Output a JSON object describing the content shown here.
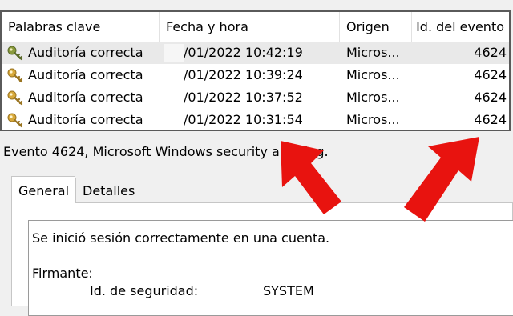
{
  "columns": {
    "keywords": "Palabras clave",
    "datetime": "Fecha y hora",
    "source": "Origen",
    "event_id": "Id. del evento"
  },
  "rows": [
    {
      "keyword": "Auditoría correcta",
      "datetime": "/01/2022 10:42:19",
      "source": "Micros...",
      "event_id": "4624",
      "selected": true
    },
    {
      "keyword": "Auditoría correcta",
      "datetime": "/01/2022 10:39:24",
      "source": "Micros...",
      "event_id": "4624"
    },
    {
      "keyword": "Auditoría correcta",
      "datetime": "/01/2022 10:37:52",
      "source": "Micros...",
      "event_id": "4624"
    },
    {
      "keyword": "Auditoría correcta",
      "datetime": "/01/2022 10:31:54",
      "source": "Micros...",
      "event_id": "4624"
    }
  ],
  "event_title": "Evento 4624, Microsoft Windows security auditing.",
  "tabs": {
    "general": "General",
    "details": "Detalles"
  },
  "description": {
    "line1": "Se inició sesión correctamente en una cuenta.",
    "signer_label": "Firmante:",
    "security_id_label": "Id. de seguridad:",
    "security_id_value": "SYSTEM"
  },
  "colors": {
    "selected_row": "#e9e9e9",
    "annotation_arrow": "#e8130f",
    "key_icon": "#d8a93a"
  },
  "icons": {
    "row_icon": "key-icon",
    "annotation": "red-arrow"
  }
}
